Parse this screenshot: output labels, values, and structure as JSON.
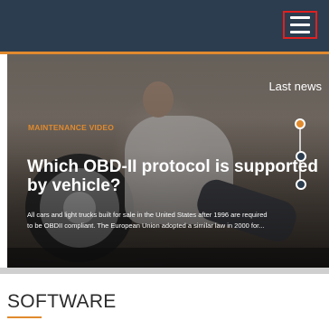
{
  "header": {
    "menu_icon": "hamburger-menu-icon",
    "accent_color": "#e08a2e",
    "background_color": "#2b3d4f"
  },
  "hero": {
    "last_news_label": "Last news",
    "tag": "MAINTENANCE VIDEO",
    "headline": "Which OBD-II protocol is supported by vehicle?",
    "excerpt": "All cars and light trucks built for sale in the United States after 1996 are required to be OBDII compliant. The European Union adopted a similar law in 2000 for..."
  },
  "section": {
    "title": "SOFTWARE"
  }
}
